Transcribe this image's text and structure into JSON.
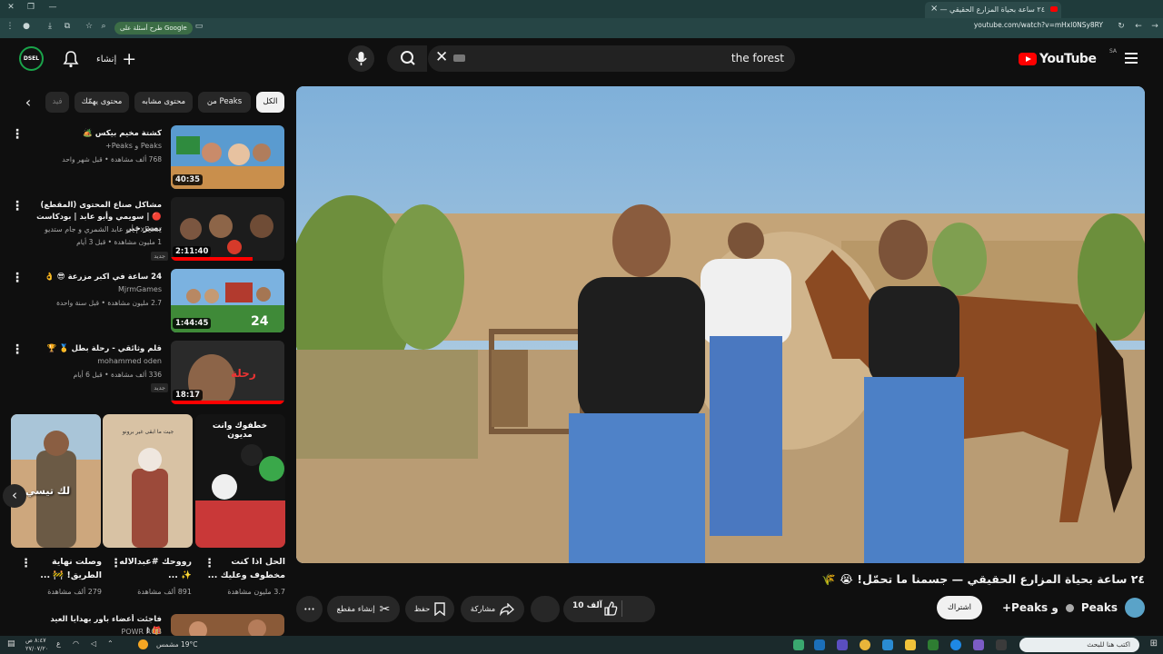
{
  "browser": {
    "tab_title": "٢٤ ساعة بحياة المزارع الحقيقي —",
    "url": "youtube.com/watch?v=mHxl0NSy8RY",
    "google_chip": "طرح أسئلة على Google",
    "new_tab": "+",
    "close_tab": "×"
  },
  "masthead": {
    "logo_text": "YouTube",
    "region": "SA",
    "search_query": "the forest",
    "create_label": "إنشاء",
    "avatar_text": "DSEL"
  },
  "video": {
    "title": "٢٤ ساعة بحياة المزارع الحقيقي — جسمنا ما تحمّل! 😭 🌾",
    "channel_name": "Peaks",
    "channel_suffix": "و Peaks+",
    "subscribe_label": "اشتراك",
    "like_count": "10 آلف",
    "share_label": "مشاركة",
    "save_label": "حفظ",
    "clip_label": "إنشاء مقطع",
    "more_label": "•••"
  },
  "chips": [
    {
      "label": "الكل",
      "active": true
    },
    {
      "label": "من Peaks",
      "active": false
    },
    {
      "label": "محتوى مشابه",
      "active": false
    },
    {
      "label": "محتوى يهمّك",
      "active": false
    },
    {
      "label": "فيد",
      "active": false
    }
  ],
  "recommendations": [
    {
      "title": "كشتة مخيم بيكس 🏕️",
      "channel": "Peaks و Peaks+",
      "meta": "768 ألف مشاهدة • قبل شهر واحد",
      "duration": "40:35",
      "new": false
    },
    {
      "title": "مشاكل صناع المحتوى (المقطع) 🔴 | سويمي وأبو عابد | بودكاست يصير خير",
      "channel": "xBear | أبو عابد الشمري و جام ستديو",
      "meta": "1 مليون مشاهدة • قبل 3 أيام",
      "duration": "2:11:40",
      "new": true
    },
    {
      "title": "24 ساعة في اكبر مزرعة 😎 👌",
      "channel": "MjrmGames",
      "meta": "2.7 مليون مشاهدة • قبل سنة واحدة",
      "duration": "1:44:45",
      "new": false
    },
    {
      "title": "قلم وثائقي - رحلة بطل 🥇 🏆",
      "channel": "mohammed oden",
      "meta": "336 ألف مشاهدة • قبل 6 أيام",
      "duration": "18:17",
      "new": true
    },
    {
      "title": "فاجئت أعضاء باور بهدايا العيد 🎁 !",
      "channel": "POWR ROB",
      "meta": "",
      "duration": "",
      "new": false
    }
  ],
  "new_badge": "جديد",
  "shorts": [
    {
      "title": "الحل اذا كنت مخطوف وعليك ...",
      "views": "3.7 مليون مشاهدة",
      "overlay": "خطفوك وانت مديون"
    },
    {
      "title": "رووحك #عبدالاله ✨ ...",
      "views": "891 ألف مشاهدة",
      "overlay": "جيت ما ابقى غير برونو"
    },
    {
      "title": "وصلت نهاية الطريق! 🚧 ...",
      "views": "279 ألف مشاهدة",
      "overlay": "لك تيسي"
    }
  ],
  "taskbar": {
    "search_placeholder": "اكتب هنا للبحث",
    "weather": "19°C مشمس",
    "clock_time": "٨:٤٧ ص",
    "clock_date": "٢٧/٠٧/٢٠"
  },
  "colors": {
    "background": "#0f0f0f",
    "youtube_red": "#ff0000",
    "browser_tab": "#1f3b3b"
  }
}
